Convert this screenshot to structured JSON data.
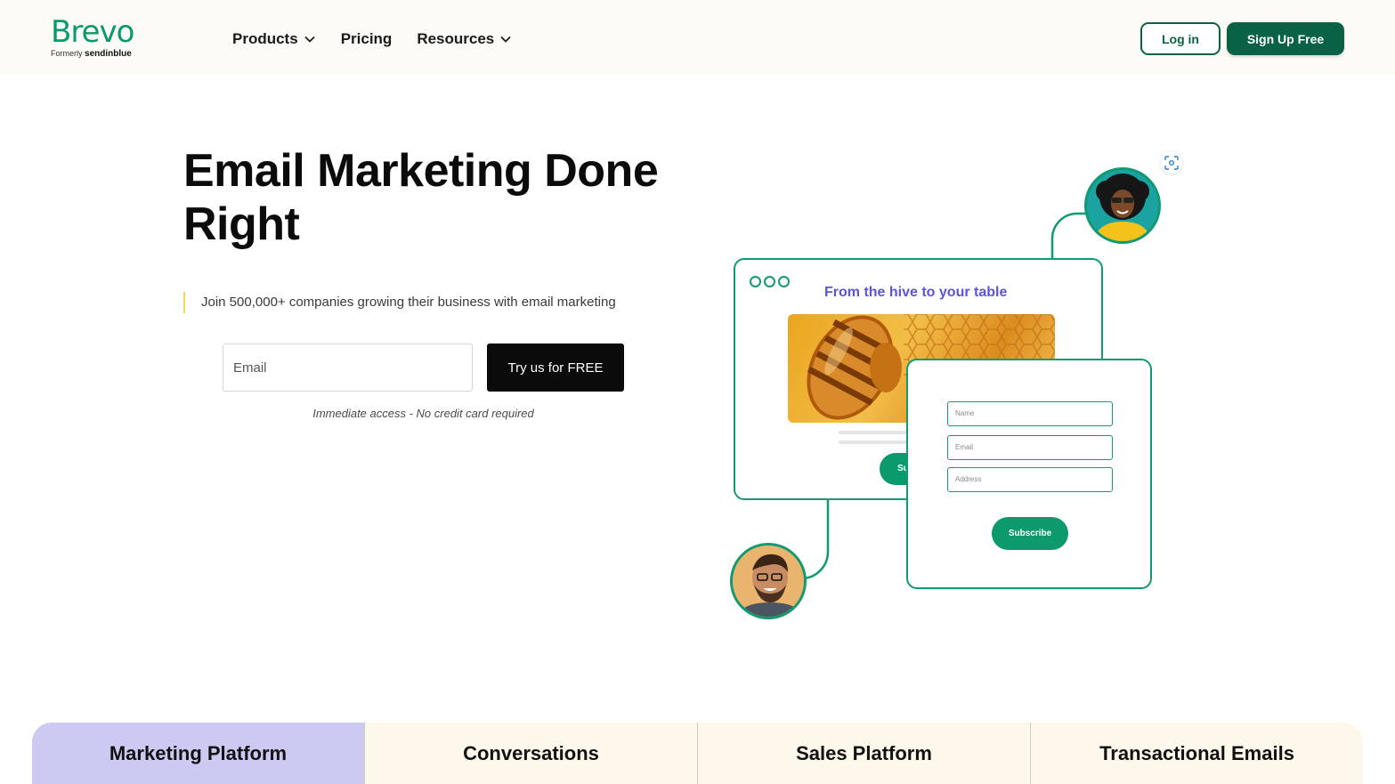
{
  "header": {
    "logo_word": "Brevo",
    "logo_formerly": "Formerly",
    "logo_old_name": "sendinblue",
    "nav": [
      {
        "label": "Products",
        "dropdown": true
      },
      {
        "label": "Pricing",
        "dropdown": false
      },
      {
        "label": "Resources",
        "dropdown": true
      }
    ],
    "login_label": "Log in",
    "signup_label": "Sign Up Free"
  },
  "hero": {
    "title": "Email Marketing Done Right",
    "subtitle": "Join 500,000+ companies growing their business with email marketing",
    "email_placeholder": "Email",
    "cta_label": "Try us for FREE",
    "note": "Immediate access - No credit card required"
  },
  "illustration": {
    "card_title": "From the hive to your table",
    "back_button_fragment": "Su",
    "fields": [
      "Name",
      "Email",
      "Address"
    ],
    "subscribe_label": "Subscribe"
  },
  "tabs": [
    {
      "label": "Marketing Platform",
      "active": true
    },
    {
      "label": "Conversations",
      "active": false
    },
    {
      "label": "Sales Platform",
      "active": false
    },
    {
      "label": "Transactional Emails",
      "active": false
    }
  ],
  "colors": {
    "brand_green": "#0a6246",
    "logo_green": "#0b996e",
    "accent_purple": "#5b55d9",
    "active_tab": "#ccc9f3",
    "tab_bg": "#fdf8e9"
  }
}
